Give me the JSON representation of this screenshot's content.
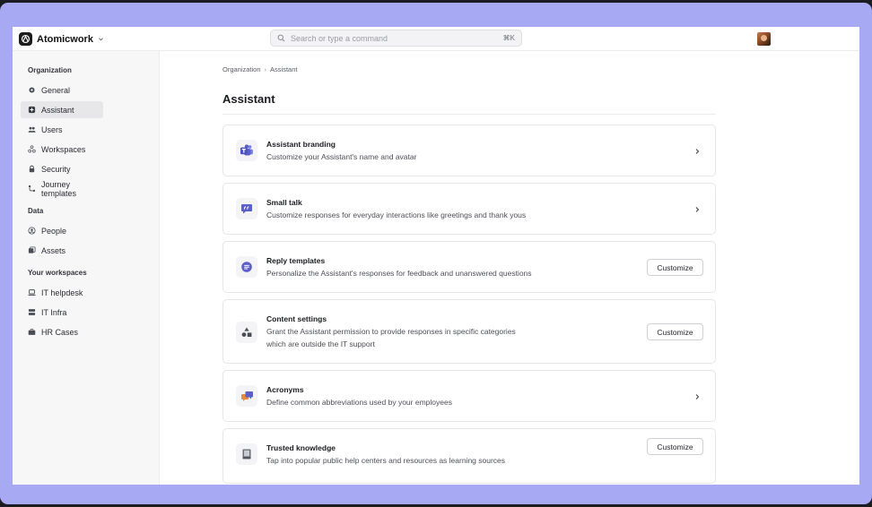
{
  "app": {
    "name": "Atomicwork",
    "search_placeholder": "Search or type a command",
    "search_shortcut": "⌘K"
  },
  "sidebar": {
    "sections": [
      {
        "label": "Organization"
      },
      {
        "label": "Data"
      },
      {
        "label": "Your workspaces"
      }
    ],
    "items": [
      {
        "label": "General",
        "icon": "gear-icon"
      },
      {
        "label": "Assistant",
        "icon": "assistant-icon",
        "active": true
      },
      {
        "label": "Users",
        "icon": "users-icon"
      },
      {
        "label": "Workspaces",
        "icon": "workspaces-icon"
      },
      {
        "label": "Security",
        "icon": "lock-icon"
      },
      {
        "label": "Journey templates",
        "icon": "journey-icon"
      },
      {
        "label": "People",
        "icon": "person-circle-icon"
      },
      {
        "label": "Assets",
        "icon": "assets-icon"
      },
      {
        "label": "IT helpdesk",
        "icon": "laptop-icon"
      },
      {
        "label": "IT Infra",
        "icon": "server-icon"
      },
      {
        "label": "HR Cases",
        "icon": "briefcase-icon"
      }
    ]
  },
  "breadcrumb": {
    "parent": "Organization",
    "separator": "›",
    "current": "Assistant"
  },
  "page": {
    "title": "Assistant"
  },
  "cards": [
    {
      "title": "Assistant branding",
      "desc": "Customize your Assistant's name and avatar",
      "action": "chevron",
      "icon": "teams-icon"
    },
    {
      "title": "Small talk",
      "desc": "Customize responses for everyday interactions like greetings and thank yous",
      "action": "chevron",
      "icon": "quote-bubble-icon"
    },
    {
      "title": "Reply templates",
      "desc": "Personalize the Assistant's responses for feedback and unanswered questions",
      "action": "button",
      "button_label": "Customize",
      "icon": "reply-bubble-icon"
    },
    {
      "title": "Content settings",
      "desc": "Grant the Assistant permission to provide responses in specific categories which are outside the IT support",
      "action": "button",
      "button_label": "Customize",
      "icon": "shapes-icon"
    },
    {
      "title": "Acronyms",
      "desc": "Define common abbreviations used by your employees",
      "action": "chevron",
      "icon": "chat-bubbles-icon"
    },
    {
      "title": "Trusted knowledge",
      "desc": "Tap into popular public help centers and resources as learning sources",
      "action": "button",
      "button_label": "Customize",
      "icon": "book-icon"
    }
  ],
  "colors": {
    "frame": "#a8a9f3",
    "brand_purple": "#5b5fc7",
    "sidebar_bg": "#f7f7f8",
    "active_item_bg": "#e7e7ea"
  }
}
